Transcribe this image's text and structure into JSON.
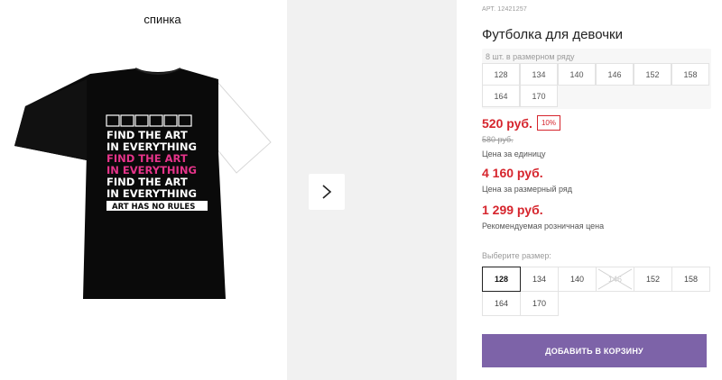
{
  "gallery": {
    "caption": "спинка",
    "print_lines": [
      "FIND THE ART",
      "IN EVERYTHING",
      "FIND THE ART",
      "IN EVERYTHING",
      "FIND THE ART",
      "IN EVERYTHING",
      "ART HAS NO RULES"
    ],
    "next_icon": "chevron-right-icon"
  },
  "product": {
    "art_label": "АРТ.",
    "art_number": "12421257",
    "title": "Футболка для девочки",
    "size_row_label": "8 шт. в размерном ряду",
    "size_row": [
      "128",
      "134",
      "140",
      "146",
      "152",
      "158",
      "164",
      "170"
    ],
    "price": "520 руб.",
    "discount": "10%",
    "old_price": "580 руб.",
    "price_unit_note": "Цена за единицу",
    "price_row": "4 160 руб.",
    "price_row_note": "Цена за размерный ряд",
    "price_rrp": "1 299 руб.",
    "price_rrp_note": "Рекомендуемая розничная цена",
    "choose_label": "Выберите размер:",
    "sizes": [
      {
        "label": "128",
        "selected": true,
        "available": true
      },
      {
        "label": "134",
        "selected": false,
        "available": true
      },
      {
        "label": "140",
        "selected": false,
        "available": true
      },
      {
        "label": "146",
        "selected": false,
        "available": false
      },
      {
        "label": "152",
        "selected": false,
        "available": true
      },
      {
        "label": "158",
        "selected": false,
        "available": true
      },
      {
        "label": "164",
        "selected": false,
        "available": true
      },
      {
        "label": "170",
        "selected": false,
        "available": true
      }
    ],
    "add_to_cart": "ДОБАВИТЬ В КОРЗИНУ"
  },
  "colors": {
    "accent": "#7d63a8",
    "price_red": "#d6252d",
    "print_pink": "#e6348a"
  }
}
